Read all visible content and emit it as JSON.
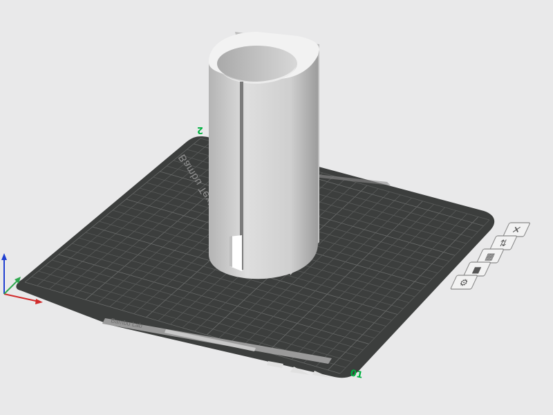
{
  "scene": {
    "background_color": "#e9e9ea",
    "plate_color": "#3c3e3d",
    "grid_line_color": "#5a5c5b",
    "model_color": "#c9c9c9"
  },
  "plate": {
    "name_label": "Bambu Textured PEI Plate",
    "plate_number_left": "2",
    "plate_number_right": "01",
    "number_color": "#00b140",
    "bottom_strip_text": "Bambu Lab"
  },
  "axes": {
    "x_color": "#d12a2a",
    "y_color": "#2fa84f",
    "z_color": "#1f3fd1"
  },
  "plate_toolbar": {
    "buttons": [
      {
        "name": "close-plate-icon",
        "glyph": "✕"
      },
      {
        "name": "auto-orient-icon",
        "glyph": "⇅"
      },
      {
        "name": "arrange-icon",
        "glyph": "▦"
      },
      {
        "name": "lock-plate-icon",
        "glyph": "■"
      },
      {
        "name": "plate-settings-icon",
        "glyph": "⚙"
      }
    ]
  }
}
